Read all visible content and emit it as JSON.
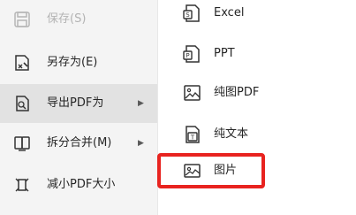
{
  "left_menu": {
    "items": [
      {
        "label": "保存(S)",
        "icon": "save-icon",
        "enabled": false
      },
      {
        "label": "另存为(E)",
        "icon": "save-as-icon"
      },
      {
        "label": "导出PDF为",
        "icon": "export-pdf-icon",
        "has_submenu": true,
        "active": true
      },
      {
        "label": "拆分合并(M)",
        "icon": "split-merge-icon",
        "has_submenu": true
      },
      {
        "label": "减小PDF大小",
        "icon": "compress-pdf-icon"
      }
    ],
    "submenu_arrow": "▶"
  },
  "submenu": {
    "items": [
      {
        "label": "Excel",
        "icon": "excel-doc-icon"
      },
      {
        "label": "PPT",
        "icon": "ppt-doc-icon"
      },
      {
        "label": "纯图PDF",
        "icon": "image-pdf-icon"
      },
      {
        "label": "纯文本",
        "icon": "plain-text-icon"
      },
      {
        "label": "图片",
        "icon": "picture-icon",
        "highlighted": true
      }
    ]
  },
  "colors": {
    "menu_bg": "#f4f4f4",
    "active_bg": "#e2e2e2",
    "highlight_border": "#e8231f"
  }
}
